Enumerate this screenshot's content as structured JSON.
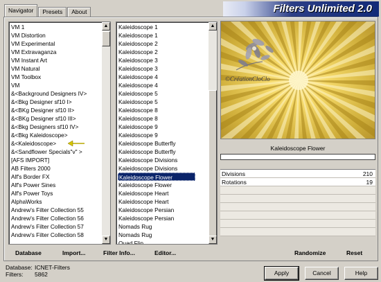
{
  "title": "Filters Unlimited 2.0",
  "tabs": [
    "Navigator",
    "Presets",
    "About"
  ],
  "categories": [
    "VM 1",
    "VM Distortion",
    "VM Experimental",
    "VM Extravaganza",
    "VM Instant Art",
    "VM Natural",
    "VM Toolbox",
    "VM",
    "&<Background Designers IV>",
    "&<Bkg Designer sf10 I>",
    "&<BKg Designer sf10 II>",
    "&<BKg Designer sf10 III>",
    "&<Bkg Designers sf10 IV>",
    "&<Bkg Kaleidoscope>",
    "&<Kaleidoscope>",
    "&<Sandflower Specials\"v\" >",
    "[AFS IMPORT]",
    "AB Filters 2000",
    "Alf's Border FX",
    "Alf's Power Sines",
    "Alf's Power Toys",
    "AlphaWorks",
    "Andrew's Filter Collection 55",
    "Andrew's Filter Collection 56",
    "Andrew's Filter Collection 57",
    "Andrew's Filter Collection 58"
  ],
  "filters": [
    "Kaleidoscope 1",
    "Kaleidoscope 1",
    "Kaleidoscope 2",
    "Kaleidoscope 2",
    "Kaleidoscope 3",
    "Kaleidoscope 3",
    "Kaleidoscope 4",
    "Kaleidoscope 4",
    "Kaleidoscope 5",
    "Kaleidoscope 5",
    "Kaleidoscope 8",
    "Kaleidoscope 8",
    "Kaleidoscope 9",
    "Kaleidoscope 9",
    "Kaleidoscope Butterfly",
    "Kaleidoscope Butterfly",
    "Kaleidoscope Divisions",
    "Kaleidoscope Divisions",
    "Kaleidoscope Flower",
    "Kaleidoscope Flower",
    "Kaleidoscope Heart",
    "Kaleidoscope Heart",
    "Kaleidoscope Persian",
    "Kaleidoscope Persian",
    "Nomads Rug",
    "Nomads Rug",
    "Quad Flip"
  ],
  "selected_filter_index": 18,
  "left_buttons": {
    "database": "Database",
    "import": "Import...",
    "filter_info": "Filter Info...",
    "editor": "Editor..."
  },
  "current_filter": "Kaleidoscope Flower",
  "watermark": "©CréationCloClo",
  "params": [
    {
      "label": "Divisions",
      "value": "210"
    },
    {
      "label": "Rotations",
      "value": "19"
    }
  ],
  "right_buttons": {
    "randomize": "Randomize",
    "reset": "Reset"
  },
  "status": {
    "database_label": "Database:",
    "database_value": "ICNET-Filters",
    "filters_label": "Filters:",
    "filters_value": "5862"
  },
  "dialog_buttons": {
    "apply": "Apply",
    "cancel": "Cancel",
    "help": "Help"
  },
  "colors": {
    "selection": "#0a246a",
    "banner": "#122a78",
    "preview_center": "#f7d96a"
  }
}
